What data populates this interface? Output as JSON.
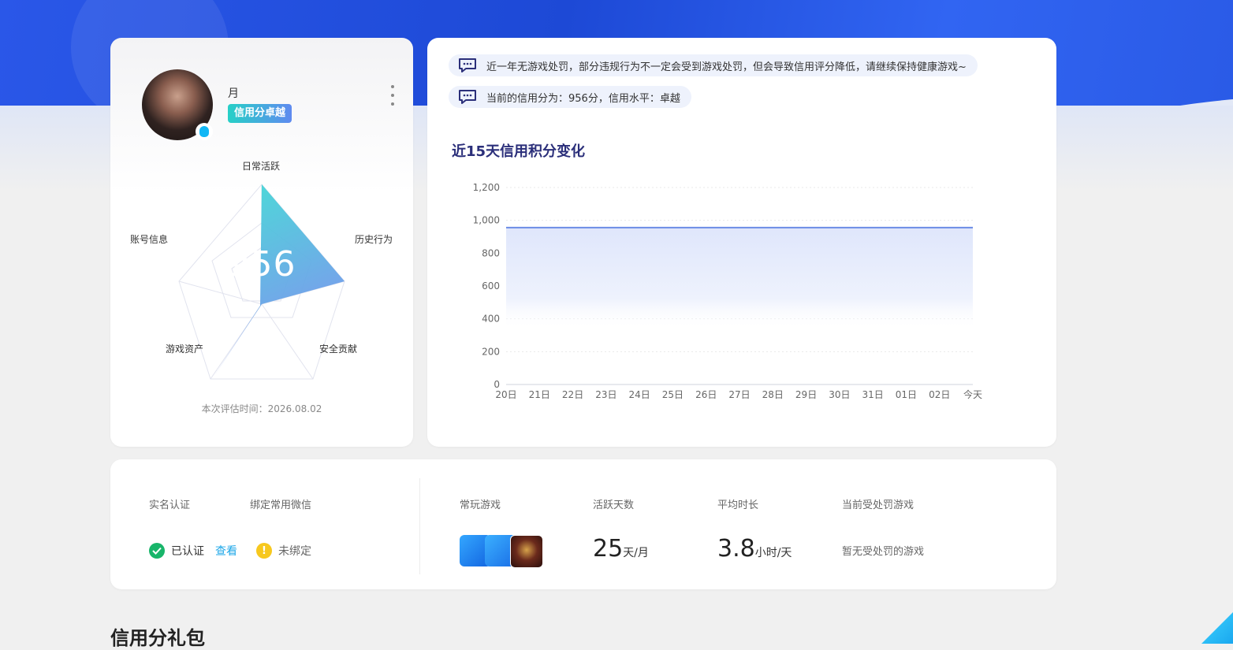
{
  "colors": {
    "accent": "#1d49d6",
    "brand_gradient_start": "#27d0c7",
    "brand_gradient_end": "#5f8af0",
    "chart_line": "#6c8de6",
    "success": "#18b56a",
    "warning": "#f7c81e",
    "link": "#1ea7e8"
  },
  "profile": {
    "username": "月",
    "level_tag": "信用分卓越",
    "score": "956",
    "eval_time_label": "本次评估时间：",
    "eval_time": "2026.08.02",
    "icons": {
      "avatar": "avatar",
      "qq": "qq-icon",
      "more": "more-vert-icon"
    },
    "radar": {
      "labels": {
        "daily": "日常活跃",
        "history": "历史行为",
        "security": "安全贡献",
        "assets": "游戏资产",
        "account": "账号信息"
      }
    }
  },
  "notices": [
    {
      "text": "近一年无游戏处罚，部分违规行为不一定会受到游戏处罚，但会导致信用评分降低，请继续保持健康游戏~",
      "icon": "message-icon"
    },
    {
      "text": "当前的信用分为：956分，信用水平：卓越",
      "icon": "message-icon"
    }
  ],
  "chart_title": "近15天信用积分变化",
  "chart_data": {
    "type": "area",
    "title": "近15天信用积分变化",
    "categories": [
      "20日",
      "21日",
      "22日",
      "23日",
      "24日",
      "25日",
      "26日",
      "27日",
      "28日",
      "29日",
      "30日",
      "31日",
      "01日",
      "02日",
      "今天"
    ],
    "values": [
      956,
      956,
      956,
      956,
      956,
      956,
      956,
      956,
      956,
      956,
      956,
      956,
      956,
      956,
      956
    ],
    "y_ticks": [
      "0",
      "200",
      "400",
      "600",
      "800",
      "1,000",
      "1,200"
    ],
    "ylim": [
      0,
      1200
    ],
    "grid": true,
    "xlabel": "",
    "ylabel": ""
  },
  "stats": {
    "real_name_label": "实名认证",
    "wechat_label": "绑定常用微信",
    "verified_text": "已认证",
    "view_link": "查看",
    "unbound_text": "未绑定",
    "frequent_games_label": "常玩游戏",
    "active_days_label": "活跃天数",
    "active_days_value": "25",
    "active_days_unit": "天/月",
    "avg_time_label": "平均时长",
    "avg_time_value": "3.8",
    "avg_time_unit": "小时/天",
    "punished_label": "当前受处罚游戏",
    "punished_value": "暂无受处罚的游戏",
    "icons": {
      "verified": "check-circle-icon",
      "warning": "exclamation-circle-icon",
      "games": [
        "game-icon-1",
        "game-icon-2",
        "game-icon-3"
      ]
    }
  },
  "section_title": "信用分礼包"
}
